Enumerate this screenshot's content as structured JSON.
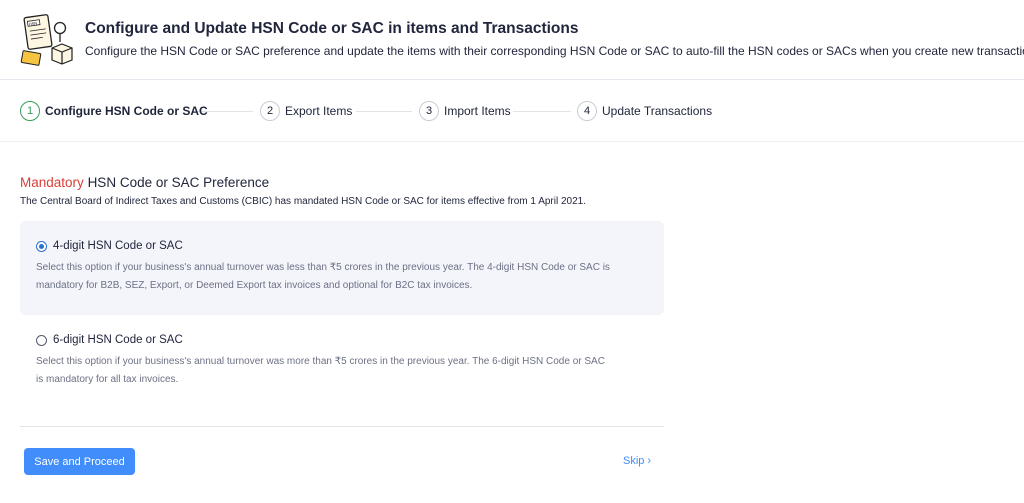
{
  "header": {
    "title": "Configure and Update HSN Code or SAC in items and Transactions",
    "subtitle": "Configure the HSN Code or SAC preference and update the items with their corresponding HSN Code or SAC to auto-fill the HSN codes or SACs when you create new transactions.",
    "illustration_label": "HSN"
  },
  "stepper": {
    "steps": [
      {
        "num": "1",
        "label": "Configure HSN Code or SAC",
        "active": true
      },
      {
        "num": "2",
        "label": "Export Items",
        "active": false
      },
      {
        "num": "3",
        "label": "Import Items",
        "active": false
      },
      {
        "num": "4",
        "label": "Update Transactions",
        "active": false
      }
    ]
  },
  "preference": {
    "mandatory": "Mandatory",
    "heading": "HSN Code or SAC Preference",
    "description": "The Central Board of Indirect Taxes and Customs (CBIC) has mandated HSN Code or SAC for items effective from 1 April 2021."
  },
  "options": [
    {
      "title": "4-digit HSN Code or SAC",
      "line1": "Select this option if your business's annual turnover was less than ₹5 crores in the previous year. The 4-digit HSN Code or SAC is",
      "line2": "mandatory for B2B, SEZ, Export, or Deemed Export tax invoices and optional for B2C tax invoices.",
      "selected": true
    },
    {
      "title": "6-digit HSN Code or SAC",
      "line1": "Select this option if your business's annual turnover was more than ₹5 crores in the previous year. The 6-digit HSN Code or SAC",
      "line2": "is mandatory for all tax invoices.",
      "selected": false
    }
  ],
  "actions": {
    "save_label": "Save and Proceed",
    "skip_label": "Skip",
    "skip_icon": "chevron-right-icon"
  },
  "colors": {
    "accent": "#408dfb",
    "mandatory": "#d9403a",
    "active_step": "#3a9d5b",
    "selected_bg": "#f3f5fa"
  }
}
